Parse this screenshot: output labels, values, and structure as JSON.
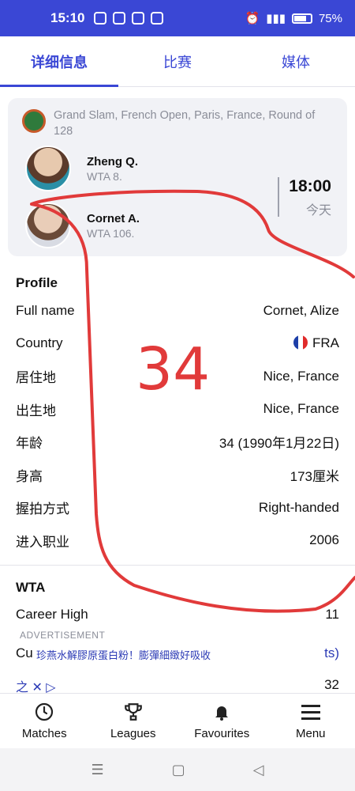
{
  "status": {
    "time": "15:10",
    "battery": "75%"
  },
  "tabs": [
    {
      "label": "详细信息"
    },
    {
      "label": "比赛"
    },
    {
      "label": "媒体"
    }
  ],
  "match": {
    "tournament": "Grand Slam, French Open, Paris, France, Round of 128",
    "player1": {
      "name": "Zheng Q.",
      "rank": "WTA 8."
    },
    "player2": {
      "name": "Cornet A.",
      "rank": "WTA 106."
    },
    "time": "18:00",
    "day": "今天"
  },
  "profile": {
    "title": "Profile",
    "rows": [
      {
        "label": "Full name",
        "value": "Cornet, Alize"
      },
      {
        "label": "Country",
        "value": "FRA"
      },
      {
        "label": "居住地",
        "value": "Nice, France"
      },
      {
        "label": "出生地",
        "value": "Nice, France"
      },
      {
        "label": "年龄",
        "value": "34 (1990年1月22日)"
      },
      {
        "label": "身高",
        "value": "173厘米"
      },
      {
        "label": "握拍方式",
        "value": "Right-handed"
      },
      {
        "label": "进入职业",
        "value": "2006"
      }
    ]
  },
  "wta": {
    "title": "WTA",
    "career_high_label": "Career High",
    "career_high_value": "11",
    "row2_label": "Cu",
    "row2_value": "ts)",
    "row3_value": "32"
  },
  "ad": {
    "label": "ADVERTISEMENT",
    "text": "珍燕水解膠原蛋白粉！膨彈細緻好吸收",
    "logo_text": "之 ✕ ▷"
  },
  "nav": [
    {
      "label": "Matches",
      "icon": "clock-icon"
    },
    {
      "label": "Leagues",
      "icon": "trophy-icon"
    },
    {
      "label": "Favourites",
      "icon": "bell-icon"
    },
    {
      "label": "Menu",
      "icon": "menu-icon"
    }
  ],
  "handwriting": "34"
}
